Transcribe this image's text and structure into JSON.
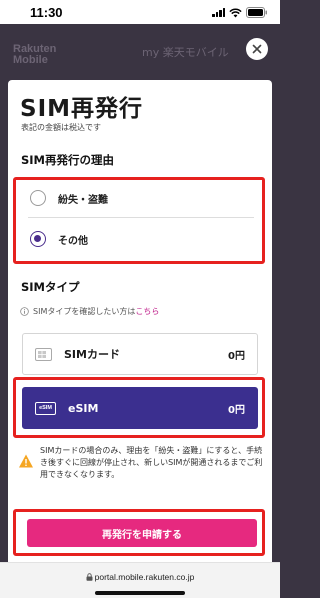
{
  "status_bar": {
    "time": "11:30"
  },
  "header": {
    "brand_line1": "Rakuten",
    "brand_line2": "Mobile",
    "my_link": "my 楽天モバイル"
  },
  "modal": {
    "title": "SIM再発行",
    "subtitle": "表記の金額は税込です",
    "reason_heading": "SIM再発行の理由",
    "reasons": [
      {
        "label": "紛失・盗難",
        "selected": false
      },
      {
        "label": "その他",
        "selected": true
      }
    ],
    "sim_type_heading": "SIMタイプ",
    "sim_type_note": "SIMタイプを確認したい方は",
    "sim_type_note_link": "こちら",
    "sim_options": [
      {
        "icon": "sim-card-icon",
        "name": "SIMカード",
        "price": "0円",
        "selected": false
      },
      {
        "icon": "esim-icon",
        "icon_text": "eSIM",
        "name": "eSIM",
        "price": "0円",
        "selected": true
      }
    ],
    "warning_text": "SIMカードの場合のみ、理由を「紛失・盗難」にすると、手続き後すぐに回線が停止され、新しいSIMが開通されるまでご利用できなくなります。",
    "submit_label": "再発行を申請する"
  },
  "browser": {
    "url": "portal.mobile.rakuten.co.jp"
  },
  "colors": {
    "accent_purple": "#3b2f8f",
    "submit_pink": "#e6297f",
    "highlight_red": "#e6211f"
  }
}
